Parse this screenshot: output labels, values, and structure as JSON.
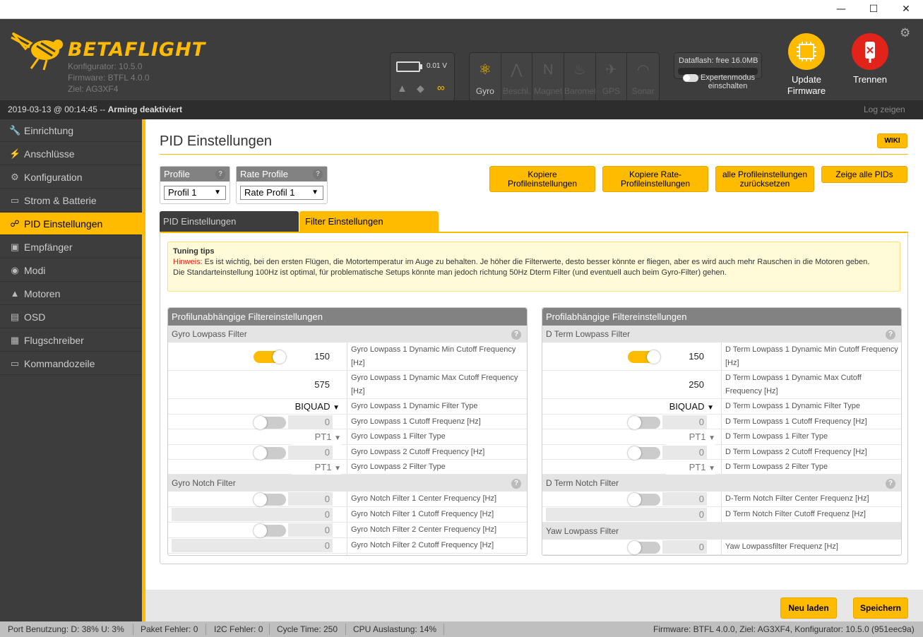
{
  "window": {
    "minimize_glyph": "—",
    "maximize_glyph": "☐",
    "close_glyph": "✕"
  },
  "brand": {
    "logo_text": "BETAFLIGHT",
    "configurator": "Konfigurator: 10.5.0",
    "firmware": "Firmware: BTFL 4.0.0",
    "target": "Ziel: AG3XF4",
    "accent_color": "#ffbb00"
  },
  "battery": {
    "voltage": "0.01 V"
  },
  "sensors": [
    {
      "label": "Gyro",
      "icon": "gyro-icon",
      "active": true
    },
    {
      "label": "Beschl.",
      "icon": "accelerometer-icon",
      "active": false
    },
    {
      "label": "Magnet",
      "icon": "magnetometer-icon",
      "active": false
    },
    {
      "label": "Barometer",
      "icon": "barometer-icon",
      "active": false
    },
    {
      "label": "GPS",
      "icon": "gps-icon",
      "active": false
    },
    {
      "label": "Sonar",
      "icon": "sonar-icon",
      "active": false
    }
  ],
  "dataflash": {
    "label": "Dataflash: free 16.0MB"
  },
  "expert": {
    "line1": "Expertenmodus",
    "line2": "einschalten"
  },
  "update_fw": {
    "line1": "Update",
    "line2": "Firmware"
  },
  "disconnect": {
    "label": "Trennen"
  },
  "status": {
    "datetime": "2019-03-13 @ 00:14:45 -- ",
    "arming": "Arming deaktiviert",
    "log_label": "Log zeigen"
  },
  "nav": [
    {
      "label": "Einrichtung",
      "icon": "wrench-icon",
      "glyph": "🔧",
      "active": false
    },
    {
      "label": "Anschlüsse",
      "icon": "plug-icon",
      "glyph": "⚡",
      "active": false
    },
    {
      "label": "Konfiguration",
      "icon": "gear-icon",
      "glyph": "⚙",
      "active": false
    },
    {
      "label": "Strom & Batterie",
      "icon": "battery-icon",
      "glyph": "▭",
      "active": false
    },
    {
      "label": "PID Einstellungen",
      "icon": "pid-icon",
      "glyph": "☍",
      "active": true
    },
    {
      "label": "Empfänger",
      "icon": "receiver-icon",
      "glyph": "▣",
      "active": false
    },
    {
      "label": "Modi",
      "icon": "modes-icon",
      "glyph": "◉",
      "active": false
    },
    {
      "label": "Motoren",
      "icon": "motor-icon",
      "glyph": "▲",
      "active": false
    },
    {
      "label": "OSD",
      "icon": "osd-icon",
      "glyph": "▤",
      "active": false
    },
    {
      "label": "Flugschreiber",
      "icon": "blackbox-icon",
      "glyph": "▦",
      "active": false
    },
    {
      "label": "Kommandozeile",
      "icon": "cli-icon",
      "glyph": "▭",
      "active": false
    }
  ],
  "page": {
    "title": "PID Einstellungen",
    "wiki": "WIKI",
    "profile_label": "Profile",
    "profile_value": "Profil 1",
    "rate_profile_label": "Rate Profile",
    "rate_profile_value": "Rate Profil 1",
    "btn_copy_profile": [
      "Kopiere",
      "Profileinstellungen"
    ],
    "btn_copy_rate": [
      "Kopiere Rate-",
      "Profileinstellungen"
    ],
    "btn_reset": [
      "alle Profileinstellungen",
      "zurücksetzen"
    ],
    "btn_show_all": "Zeige alle PIDs",
    "tab_pid": "PID Einstellungen",
    "tab_filter": "Filter Einstellungen"
  },
  "tips": {
    "title": "Tuning tips",
    "hint_label": "Hinweis:",
    "hint_text": " Es ist wichtig, bei den ersten Flügen, die Motortemperatur im Auge zu behalten. Je höher die Filterwerte, desto besser könnte er fliegen, aber es wird auch mehr Rauschen in die Motoren geben.",
    "line2": "Die Standarteinstellung 100Hz ist optimal, für problematische Setups könnte man jedoch richtung 50Hz Dterm Filter (und eventuell auch beim Gyro-Filter) gehen."
  },
  "left_panel": {
    "title": "Profilunabhängige Filtereinstellungen",
    "lowpass_title": "Gyro Lowpass Filter",
    "notch_title": "Gyro Notch Filter",
    "rows": {
      "dyn_min_val": "150",
      "dyn_min_desc": "Gyro Lowpass 1 Dynamic Min Cutoff Frequency [Hz]",
      "dyn_max_val": "575",
      "dyn_max_desc": "Gyro Lowpass 1 Dynamic Max Cutoff Frequency [Hz]",
      "dyn_type_val": "BIQUAD",
      "dyn_type_desc": "Gyro Lowpass 1 Dynamic Filter Type",
      "lp1_val": "0",
      "lp1_desc": "Gyro Lowpass 1 Cutoff Frequenz [Hz]",
      "lp1_type_val": "PT1",
      "lp1_type_desc": "Gyro Lowpass 1 Filter Type",
      "lp2_val": "0",
      "lp2_desc": "Gyro Lowpass 2 Cutoff Frequency [Hz]",
      "lp2_type_val": "PT1",
      "lp2_type_desc": "Gyro Lowpass 2 Filter Type",
      "n1c_val": "0",
      "n1c_desc": "Gyro Notch Filter 1 Center Frequency [Hz]",
      "n1o_val": "0",
      "n1o_desc": "Gyro Notch Filter 1 Cutoff Frequency [Hz]",
      "n2c_val": "0",
      "n2c_desc": "Gyro Notch Filter 2 Center Frequency [Hz]",
      "n2o_val": "0",
      "n2o_desc": "Gyro Notch Filter 2 Cutoff Frequency [Hz]"
    }
  },
  "right_panel": {
    "title": "Profilabhängige Filtereinstellungen",
    "lowpass_title": "D Term Lowpass Filter",
    "notch_title": "D Term Notch Filter",
    "yaw_title": "Yaw Lowpass Filter",
    "rows": {
      "dyn_min_val": "150",
      "dyn_min_desc": "D Term Lowpass 1 Dynamic Min Cutoff Frequency [Hz]",
      "dyn_max_val": "250",
      "dyn_max_desc": "D Term Lowpass 1 Dynamic Max Cutoff Frequency [Hz]",
      "dyn_type_val": "BIQUAD",
      "dyn_type_desc": "D Term Lowpass 1 Dynamic Filter Type",
      "lp1_val": "0",
      "lp1_desc": "D Term Lowpass 1 Cutoff Frequency [Hz]",
      "lp1_type_val": "PT1",
      "lp1_type_desc": "D Term Lowpass 1 Filter Type",
      "lp2_val": "0",
      "lp2_desc": "D Term Lowpass 2 Cutoff Frequency [Hz]",
      "lp2_type_val": "PT1",
      "lp2_type_desc": "D Term Lowpass 2 Filter Type",
      "nc_val": "0",
      "nc_desc": "D-Term Notch Filter Center Frequenz [Hz]",
      "no_val": "0",
      "no_desc": "D Term Notch Filter Cutoff Frequenz [Hz]",
      "yaw_val": "0",
      "yaw_desc": "Yaw Lowpassfilter Frequenz [Hz]"
    }
  },
  "footer": {
    "reload": "Neu laden",
    "save": "Speichern"
  },
  "bottom": {
    "port": "Port Benutzung: D: 38% U: 3%",
    "packet": "Paket Fehler: 0",
    "i2c": "I2C Fehler: 0",
    "cycle": "Cycle Time: 250",
    "cpu": "CPU Auslastung: 14%",
    "fw": "Firmware: BTFL 4.0.0, Ziel: AG3XF4, Konfigurator: 10.5.0 (951eec9a)"
  }
}
